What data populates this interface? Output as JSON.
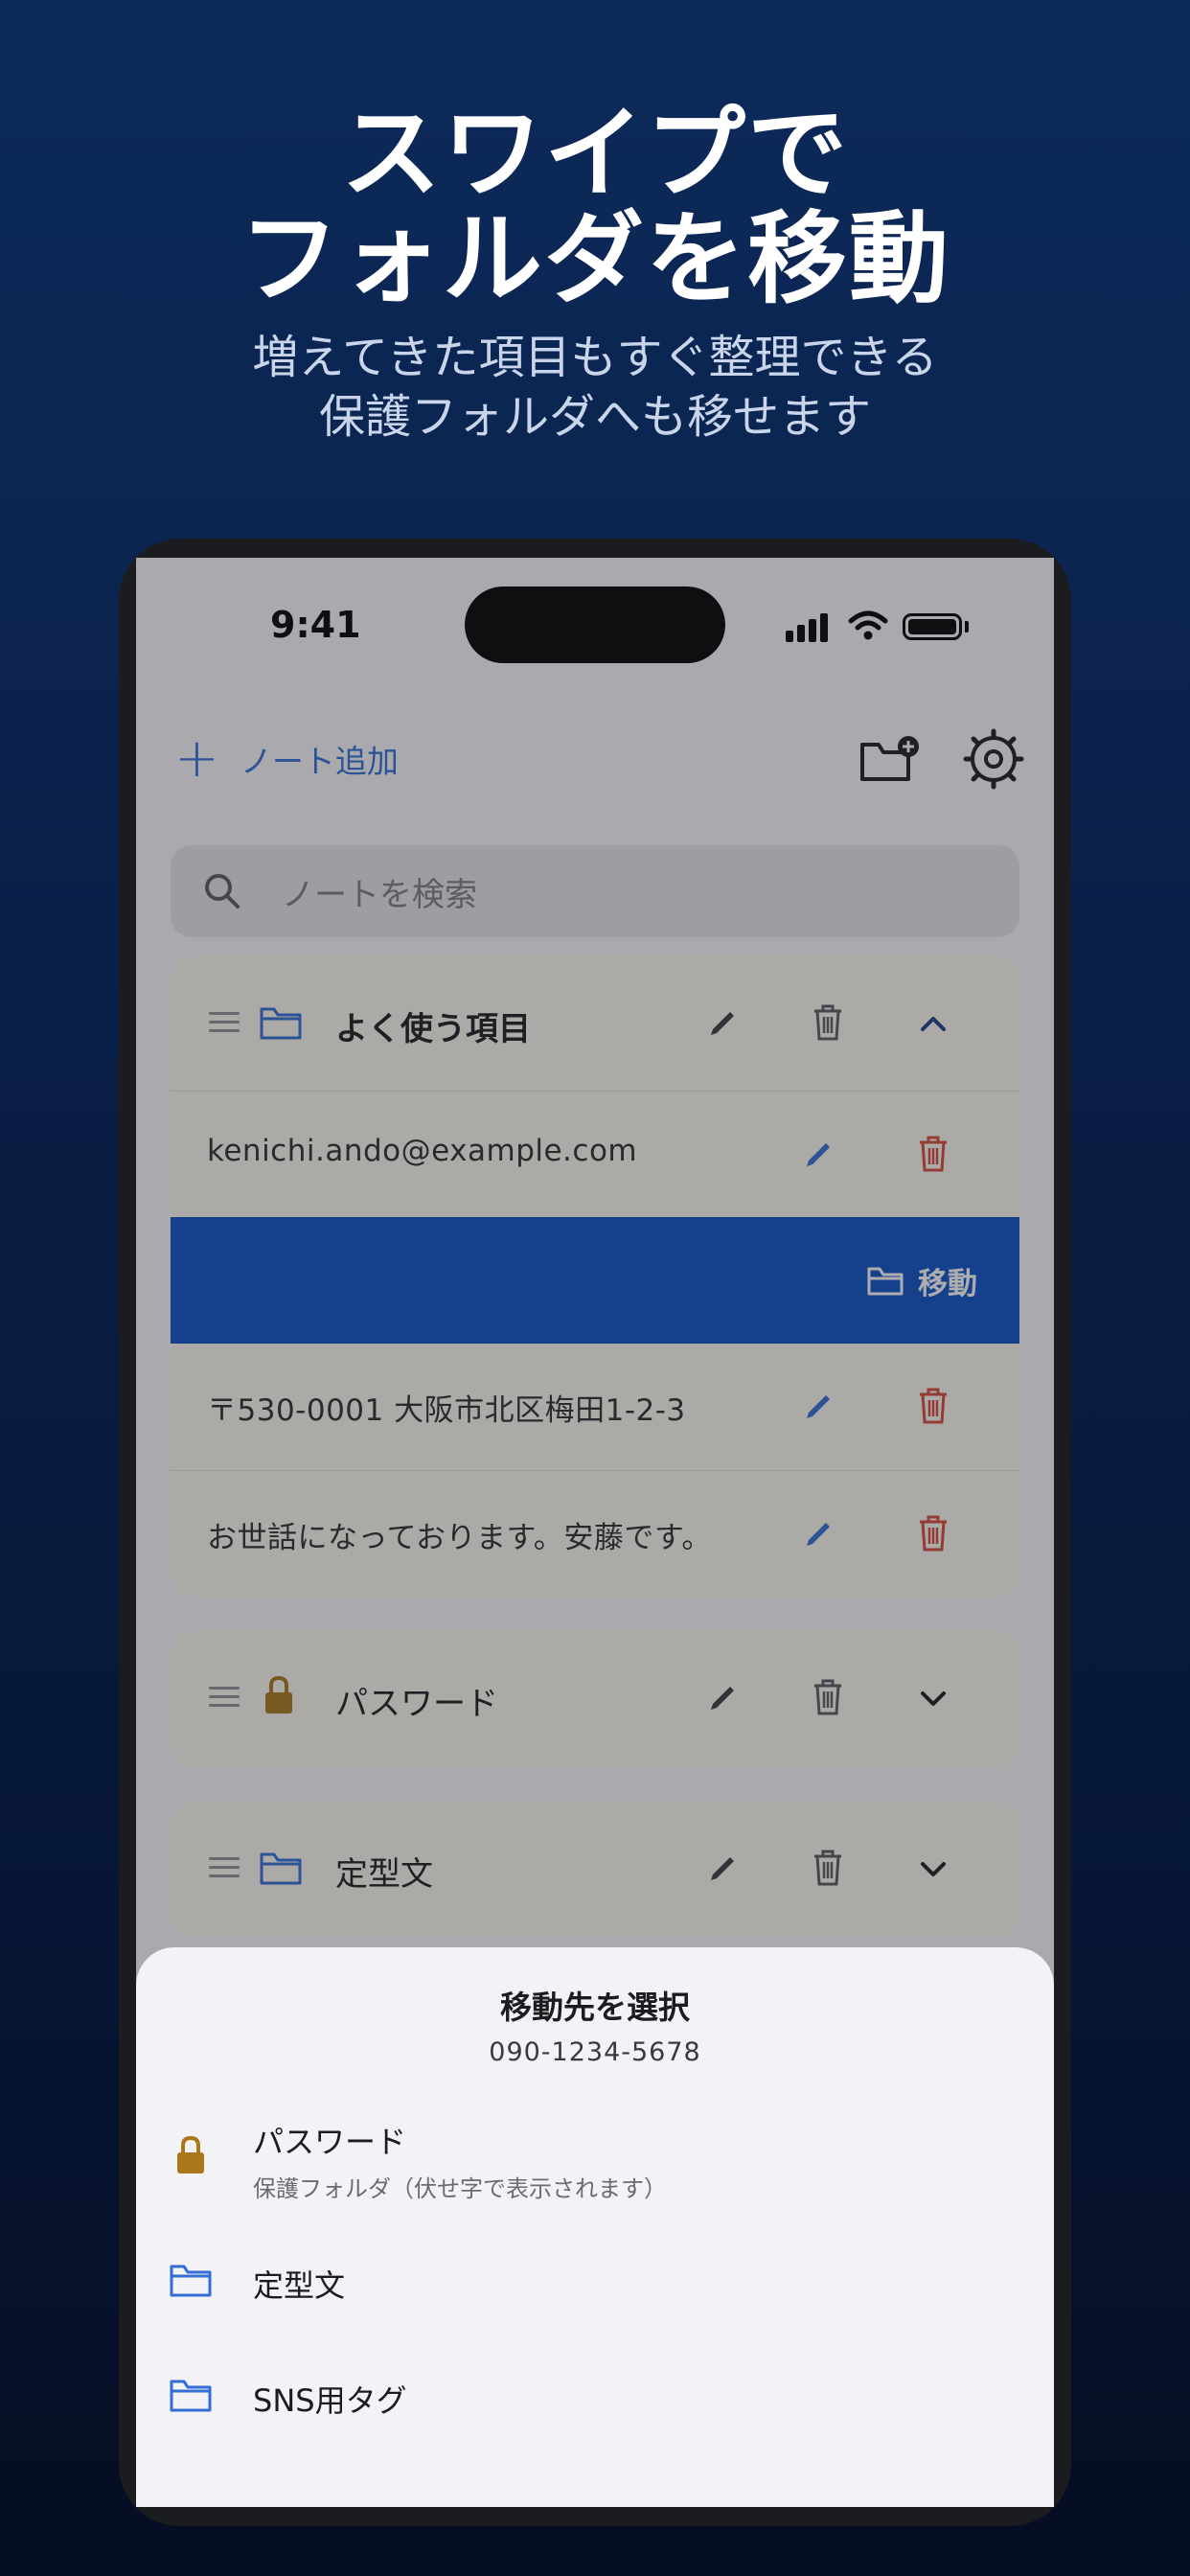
{
  "promo": {
    "headline_line1": "スワイプで",
    "headline_line2": "フォルダを移動",
    "subline_line1": "増えてきた項目もすぐ整理できる",
    "subline_line2": "保護フォルダへも移せます"
  },
  "status_bar": {
    "time": "9:41"
  },
  "toolbar": {
    "add_note_label": "ノート追加",
    "add_folder_icon": "folder-plus-icon",
    "settings_icon": "gear-icon"
  },
  "search": {
    "placeholder": "ノートを検索"
  },
  "folders": [
    {
      "title": "よく使う項目",
      "icon": "folder-icon",
      "expanded": true,
      "items": [
        {
          "text": "kenichi.ando@example.com"
        },
        {
          "text": "",
          "swiped": true,
          "action_label": "移動"
        },
        {
          "text": "〒530-0001 大阪市北区梅田1-2-3"
        },
        {
          "text": "お世話になっております。安藤です。"
        }
      ]
    },
    {
      "title": "パスワード",
      "icon": "lock-icon",
      "expanded": false
    },
    {
      "title": "定型文",
      "icon": "folder-icon",
      "expanded": false
    }
  ],
  "sheet": {
    "title": "移動先を選択",
    "subtitle": "090-1234-5678",
    "destinations": [
      {
        "label": "パスワード",
        "description": "保護フォルダ（伏せ字で表示されます）",
        "icon": "lock-icon"
      },
      {
        "label": "定型文",
        "icon": "folder-icon"
      },
      {
        "label": "SNS用タグ",
        "icon": "folder-icon"
      }
    ]
  },
  "colors": {
    "accent": "#2f6fd6",
    "swipe_bg": "#0a52c6",
    "delete": "#d64a3a",
    "lock": "#a8781a",
    "card_bg": "#fdfbf0"
  }
}
